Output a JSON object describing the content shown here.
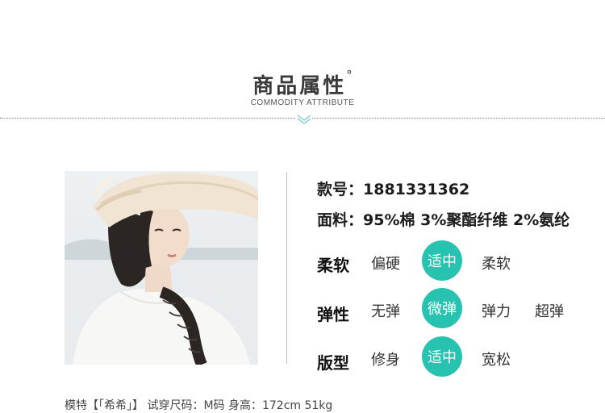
{
  "header": {
    "title": "商品属性",
    "degree": "°",
    "subtitle": "COMMODITY ATTRIBUTE",
    "chevron_icon": "double-chevron-down-icon",
    "accent_color": "#7fcfc6"
  },
  "specs": {
    "item_no_label": "款号：",
    "item_no_value": "1881331362",
    "fabric_label": "面料：",
    "fabric_value": "95%棉 3%聚酯纤维 2%氨纶"
  },
  "attributes": {
    "highlight_color": "#28c2b1",
    "softness": {
      "label": "柔软",
      "options": [
        "偏硬",
        "适中",
        "柔软"
      ],
      "selected": "适中"
    },
    "elasticity": {
      "label": "弹性",
      "options": [
        "无弹",
        "微弹",
        "弹力",
        "超弹"
      ],
      "selected": "微弹"
    },
    "fit": {
      "label": "版型",
      "options": [
        "修身",
        "适中",
        "宽松"
      ],
      "selected": "适中"
    }
  },
  "model_info": {
    "text": "模特【「希希」】 试穿尺码：M码 身高：172cm 51kg"
  }
}
